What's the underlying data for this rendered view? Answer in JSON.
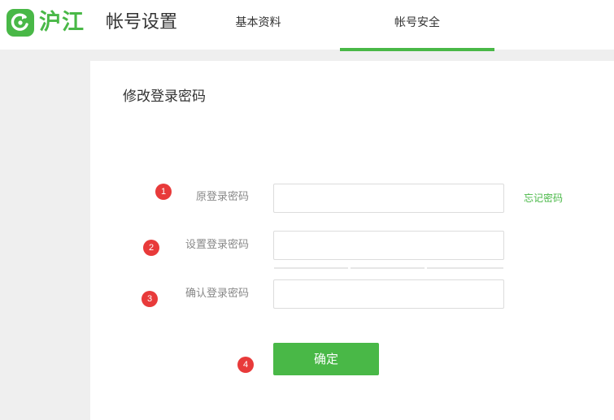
{
  "header": {
    "logo_text": "沪江",
    "page_title": "帐号设置",
    "tabs": [
      {
        "label": "基本资料",
        "active": false
      },
      {
        "label": "帐号安全",
        "active": true
      }
    ]
  },
  "panel": {
    "title": "修改登录密码",
    "fields": [
      {
        "label": "原登录密码",
        "value": "",
        "marker": "1"
      },
      {
        "label": "设置登录密码",
        "value": "",
        "marker": "2"
      },
      {
        "label": "确认登录密码",
        "value": "",
        "marker": "3"
      }
    ],
    "forgot_link": "忘记密码",
    "submit_label": "确定",
    "submit_marker": "4"
  },
  "colors": {
    "brand": "#49b847",
    "marker": "#e83a3a"
  },
  "icons": {
    "logo": "refresh-arrow-icon"
  }
}
